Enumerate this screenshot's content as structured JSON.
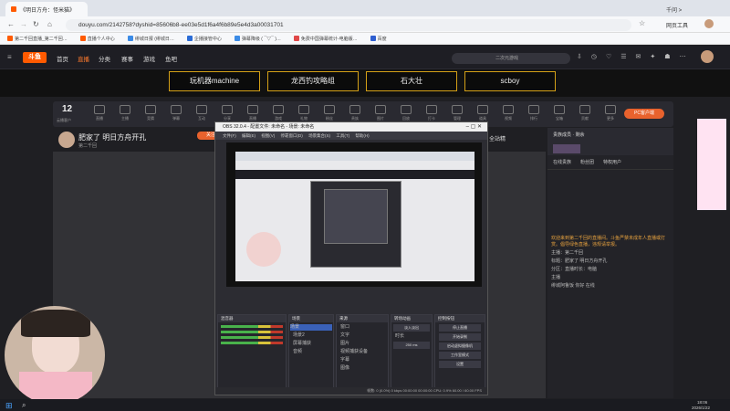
{
  "browser": {
    "tabs": [
      {
        "label": "《明日方舟：怪米猫》"
      },
      {
        "label": "千问 >"
      }
    ],
    "url": "douyu.com/2142758?dyshid=85606b8-ee03e5d1f6a4f6b89e5e4d3a00031701",
    "bookmarks": [
      "第二千回直播_第二千回…",
      "直播个人中心",
      "绯城日报 (绯城日…",
      "企播接管中心",
      "弹幕降级 ( ¯▽¯ )…",
      "免费中国弹幕统计-电脑版…",
      "百度"
    ],
    "profile_label": "网页工具"
  },
  "site": {
    "logo": "斗鱼",
    "nav": [
      "首页",
      "直播",
      "分类",
      "赛事",
      "游戏",
      "鱼吧"
    ],
    "search_placeholder": "二次元游戏"
  },
  "banner": {
    "buttons": [
      "玩机器machine",
      "龙西钓攻略组",
      "石大壮",
      "scboy"
    ]
  },
  "room": {
    "count": "12",
    "count_label": "云播客户",
    "pc_button": "PC客户端",
    "streamer_title": "肥家了 明日方舟开孔",
    "host_name": "第二千回",
    "follow": "关注",
    "fullsite_label": "全站精",
    "icon_labels": [
      "直播",
      "主播",
      "竞猜",
      "弹幕",
      "互动",
      "分享",
      "直播",
      "游戏",
      "礼物",
      "粉丝",
      "贵族",
      "图片",
      "回放",
      "打卡",
      "管理",
      "道具",
      "视频",
      "排行",
      "宝箱",
      "贡献",
      "更多"
    ]
  },
  "obs": {
    "title": "OBS 32.0.4 - 配置文件: 未命名 - 场景: 未命名",
    "menu": [
      "文件(F)",
      "编辑(E)",
      "视图(V)",
      "停靠窗口(D)",
      "场景集合(S)",
      "工具(T)",
      "帮助(H)"
    ],
    "panels": {
      "sources": "来源",
      "scenes": "场景",
      "mixer": "混音器",
      "transitions": "转场动画",
      "controls": "控制按钮"
    },
    "scene_items": [
      "场景",
      "场景2",
      "屏幕捕获",
      "音频"
    ],
    "source_items": [
      "窗口",
      "文字",
      "图片",
      "视频捕获设备",
      "字幕",
      "图像"
    ],
    "transition_value": "淡入淡出",
    "duration_label": "时长",
    "duration_value": "250 ms",
    "control_buttons": [
      "停止直播",
      "开始录制",
      "启动虚拟摄像机",
      "工作室模式",
      "设置"
    ],
    "status": "帧数: 0 (0.0%)   0 kbps   00:00:00   00:00:00   CPU: 0.9%   60.00 / 60.00 FPS"
  },
  "chat": {
    "tabs": [
      "在线贵族",
      "粉丝团",
      "特权用户"
    ],
    "rank_title": "贵族成员 · 剩余",
    "lines": [
      "欢迎来到第二千回的直播间。斗鱼严禁未成年人直播或打赏。倡导绿色直播，违规请举报。",
      "主播：第二千回",
      "标题：肥家了 明日方舟开孔",
      "分区：直播时长：电脑",
      "主播",
      "绯城阿鲁饭 你好 在线"
    ]
  },
  "taskbar": {
    "time": "18:06",
    "date": "2026/1/22"
  }
}
